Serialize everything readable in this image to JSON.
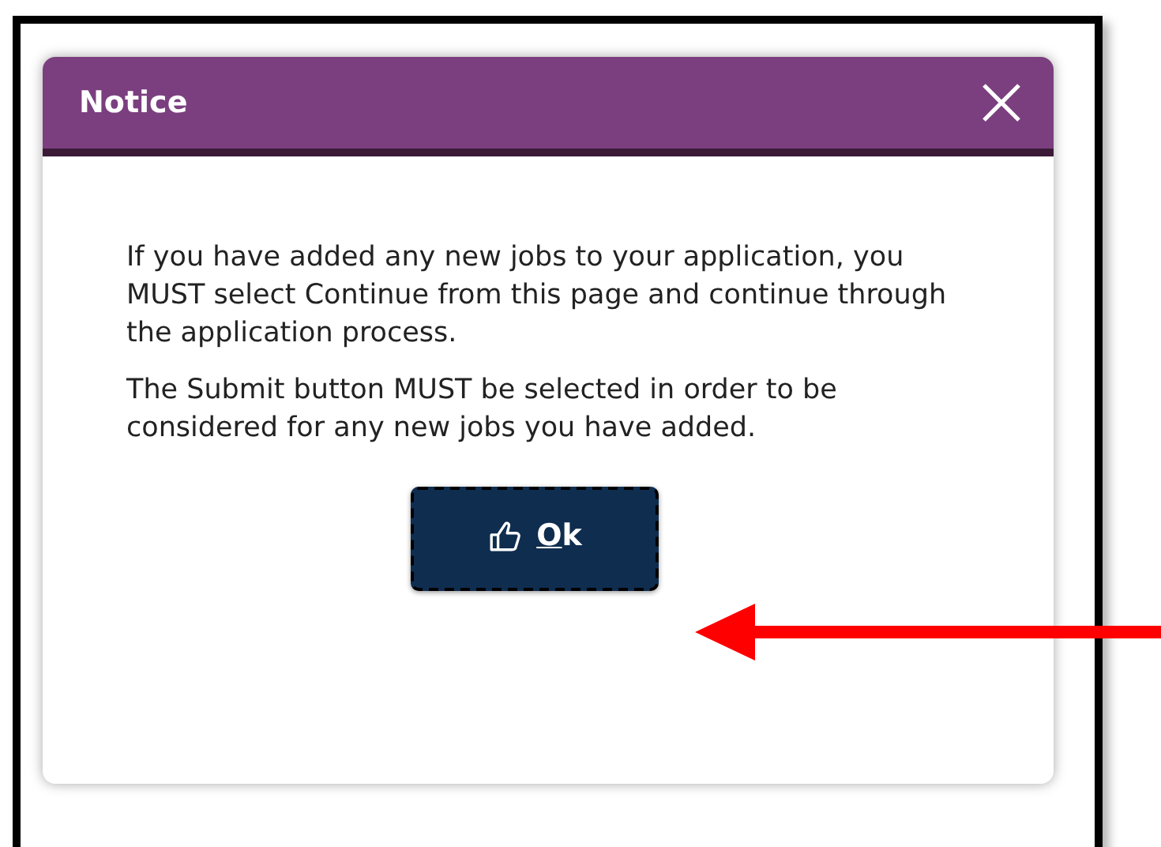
{
  "dialog": {
    "title": "Notice",
    "paragraphs": [
      "If you have added any new jobs to your application, you MUST select Continue from this page and continue through the application process.",
      "The Submit button MUST be selected in order to be considered for any new jobs you have added."
    ],
    "buttons": [
      {
        "label": "Ok",
        "kind": "ok"
      }
    ]
  },
  "annotation": {
    "kind": "arrow",
    "color": "#ff0000"
  }
}
